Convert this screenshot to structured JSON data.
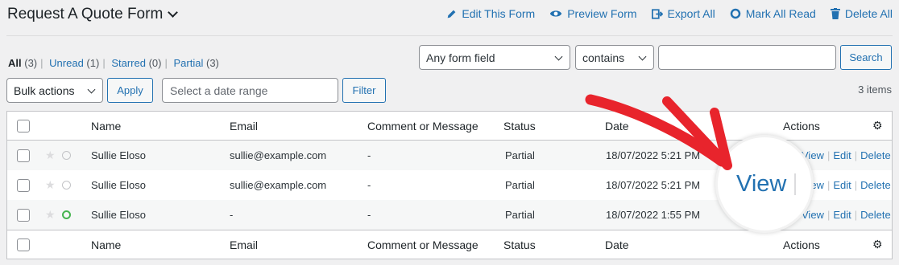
{
  "header": {
    "title": "Request A Quote Form",
    "actions": [
      {
        "label": "Edit This Form",
        "icon": "pencil-icon"
      },
      {
        "label": "Preview Form",
        "icon": "eye-icon"
      },
      {
        "label": "Export All",
        "icon": "export-icon"
      },
      {
        "label": "Mark All Read",
        "icon": "circle-icon"
      },
      {
        "label": "Delete All",
        "icon": "trash-icon"
      }
    ]
  },
  "views": {
    "all": {
      "label": "All",
      "count": "(3)"
    },
    "unread": {
      "label": "Unread",
      "count": "(1)"
    },
    "starred": {
      "label": "Starred",
      "count": "(0)"
    },
    "partial": {
      "label": "Partial",
      "count": "(3)"
    }
  },
  "search": {
    "field_select": "Any form field",
    "operator_select": "contains",
    "query": "",
    "button": "Search"
  },
  "bulk": {
    "select": "Bulk actions",
    "apply": "Apply",
    "date_placeholder": "Select a date range",
    "filter": "Filter"
  },
  "items_count": "3 items",
  "table": {
    "columns": {
      "name": "Name",
      "email": "Email",
      "comment": "Comment or Message",
      "status": "Status",
      "date": "Date",
      "actions": "Actions"
    },
    "rows": [
      {
        "name": "Sullie Eloso",
        "email": "sullie@example.com",
        "comment": "-",
        "status": "Partial",
        "date": "18/07/2022 5:21 PM",
        "read": true
      },
      {
        "name": "Sullie Eloso",
        "email": "sullie@example.com",
        "comment": "-",
        "status": "Partial",
        "date": "18/07/2022 5:21 PM",
        "read": true
      },
      {
        "name": "Sullie Eloso",
        "email": "-",
        "comment": "-",
        "status": "Partial",
        "date": "18/07/2022 1:55 PM",
        "read": false
      }
    ],
    "row_actions": {
      "view": "View",
      "edit": "Edit",
      "delete": "Delete"
    }
  },
  "colors": {
    "link": "#2271b1",
    "unread_dot": "#46b450",
    "arrow": "#e8242c"
  }
}
